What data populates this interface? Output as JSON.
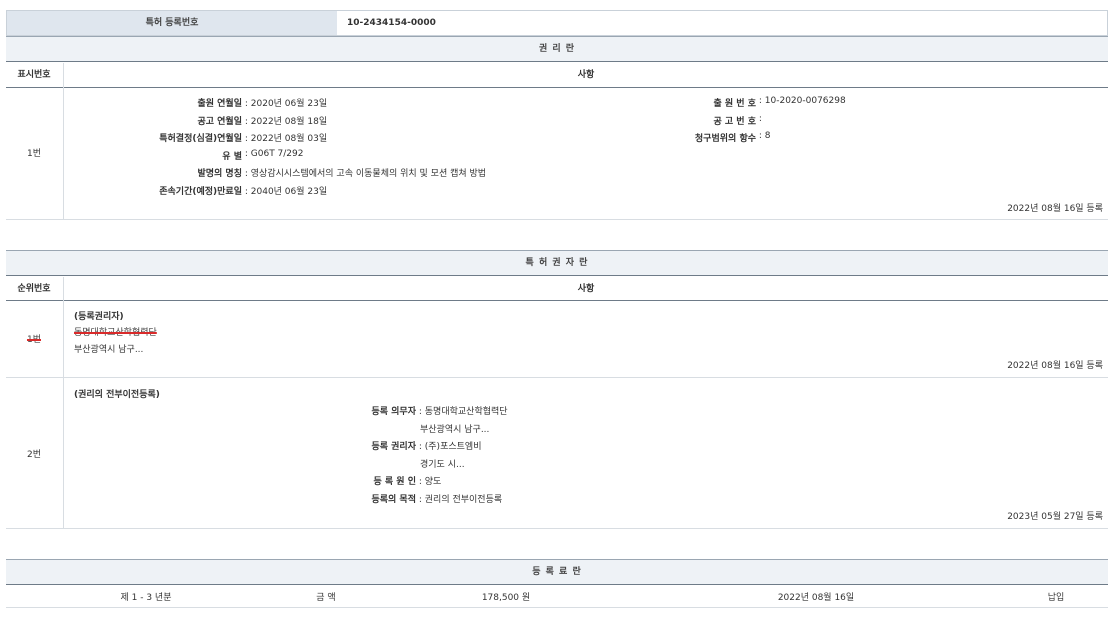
{
  "top": {
    "label": "특허 등록번호",
    "value": "10-2434154-0000"
  },
  "rights_section": {
    "title": "권 리 란",
    "col_no": "표시번호",
    "col_item": "사항",
    "row_no": "1번",
    "left_fields": [
      {
        "label": "출원 연월일",
        "value": "2020년 06월 23일"
      },
      {
        "label": "공고 연월일",
        "value": "2022년 08월 18일"
      },
      {
        "label": "특허결정(심결)연월일",
        "value": "2022년 08월 03일"
      },
      {
        "label": "유 별",
        "value": "G06T 7/292"
      },
      {
        "label": "발명의 명칭",
        "value": "영상감시시스템에서의 고속 이동물체의 위치 및 모션 캡쳐 방법"
      },
      {
        "label": "존속기간(예정)만료일",
        "value": "2040년 06월 23일"
      }
    ],
    "right_fields": [
      {
        "label": "출 원 번 호",
        "value": "10-2020-0076298"
      },
      {
        "label": "공 고 번 호",
        "value": ""
      },
      {
        "label": "청구범위의 항수",
        "value": "8"
      }
    ],
    "reg_date": "2022년 08월 16일 등록"
  },
  "holder_section": {
    "title": "특 허 권 자 란",
    "col_no": "순위번호",
    "col_item": "사항",
    "row1": {
      "no": "1번",
      "heading": "(등록권리자)",
      "name": "동명대학교산학협력단",
      "address": "부산광역시 남구...",
      "reg_date": "2022년 08월 16일 등록"
    },
    "row2": {
      "no": "2번",
      "heading": "(권리의 전부이전등록)",
      "fields": [
        {
          "label": "등록 의무자",
          "value": "동명대학교산학협력단"
        },
        {
          "label": "",
          "value": "부산광역시 남구..."
        },
        {
          "label": "등록 권리자",
          "value": "(주)포스트엠비"
        },
        {
          "label": "",
          "value": "경기도 시..."
        },
        {
          "label": "등 록 원 인",
          "value": "양도"
        },
        {
          "label": "등록의 목적",
          "value": "권리의 전부이전등록"
        }
      ],
      "reg_date": "2023년 05월 27일 등록"
    }
  },
  "fee_section": {
    "title": "등 록 료 란",
    "year": "제 1 - 3 년분",
    "amount_label": "금 액",
    "amount": "178,500 원",
    "date": "2022년 08월 16일",
    "status": "납입"
  }
}
